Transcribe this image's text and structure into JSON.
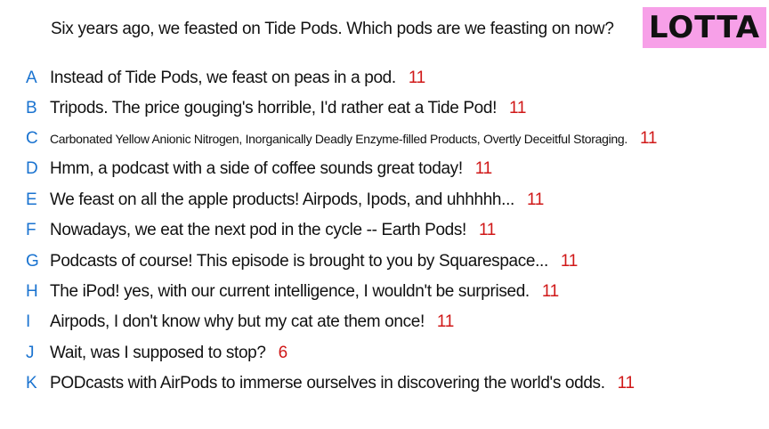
{
  "prompt": "Six years ago, we feasted on Tide Pods. Which pods are we feasting on now?",
  "badge": "LOTTA",
  "colors": {
    "badge_bg": "#f7a0e8",
    "letter": "#1a73d0",
    "score": "#d01818"
  },
  "answers": [
    {
      "letter": "A",
      "text": "Instead of Tide Pods, we feast on peas in a pod.",
      "score": "11"
    },
    {
      "letter": "B",
      "text": "Tripods. The price gouging's horrible, I'd rather eat a Tide Pod!",
      "score": "11"
    },
    {
      "letter": "C",
      "text": "Carbonated Yellow Anionic Nitrogen, Inorganically Deadly Enzyme-filled Products, Overtly Deceitful Storaging.",
      "score": "11"
    },
    {
      "letter": "D",
      "text": "Hmm, a podcast with a side of coffee sounds great today!",
      "score": "11"
    },
    {
      "letter": "E",
      "text": "We feast on all the apple products! Airpods, Ipods, and uhhhhh...",
      "score": "11"
    },
    {
      "letter": "F",
      "text": "Nowadays, we eat the next pod in the cycle -- Earth Pods!",
      "score": "11"
    },
    {
      "letter": "G",
      "text": "Podcasts of course! This episode is brought to you by Squarespace...",
      "score": "11"
    },
    {
      "letter": "H",
      "text": "The iPod! yes, with our current intelligence, I wouldn't be surprised.",
      "score": "11"
    },
    {
      "letter": "I",
      "text": "Airpods, I don't know why but my cat ate them once!",
      "score": "11"
    },
    {
      "letter": "J",
      "text": "Wait, was I supposed to stop?",
      "score": "6"
    },
    {
      "letter": "K",
      "text": "PODcasts with AirPods to immerse ourselves in discovering the world's odds.",
      "score": "11"
    }
  ]
}
